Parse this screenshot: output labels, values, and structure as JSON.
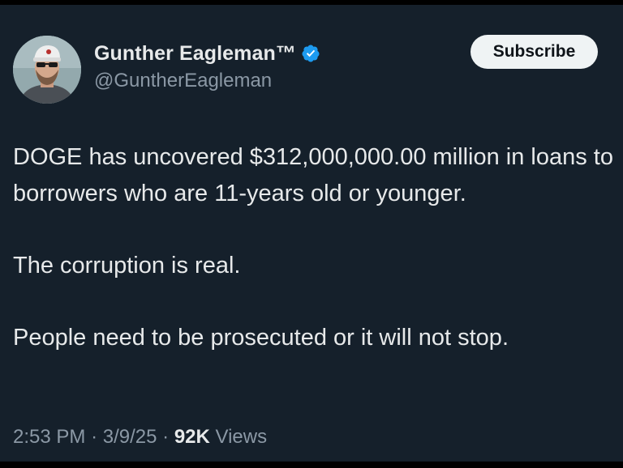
{
  "author": {
    "display_name": "Gunther Eagleman™",
    "handle": "@GuntherEagleman",
    "verified": true
  },
  "actions": {
    "subscribe_label": "Subscribe"
  },
  "post": {
    "paragraphs": [
      "DOGE has uncovered $312,000,000.00 million in loans to borrowers who are 11-years old or younger.",
      "The corruption is real.",
      "People need to be prosecuted or it will not stop."
    ]
  },
  "meta": {
    "time": "2:53 PM",
    "date": "3/9/25",
    "separator": "·",
    "views_count": "92K",
    "views_label": "Views"
  },
  "colors": {
    "background": "#15202b",
    "text": "#e7e9ea",
    "secondary_text": "#8b98a5",
    "verified_badge": "#1d9bf0",
    "button_bg": "#eff3f4"
  },
  "icons": {
    "avatar": "avatar",
    "verified": "verified-badge-icon"
  }
}
